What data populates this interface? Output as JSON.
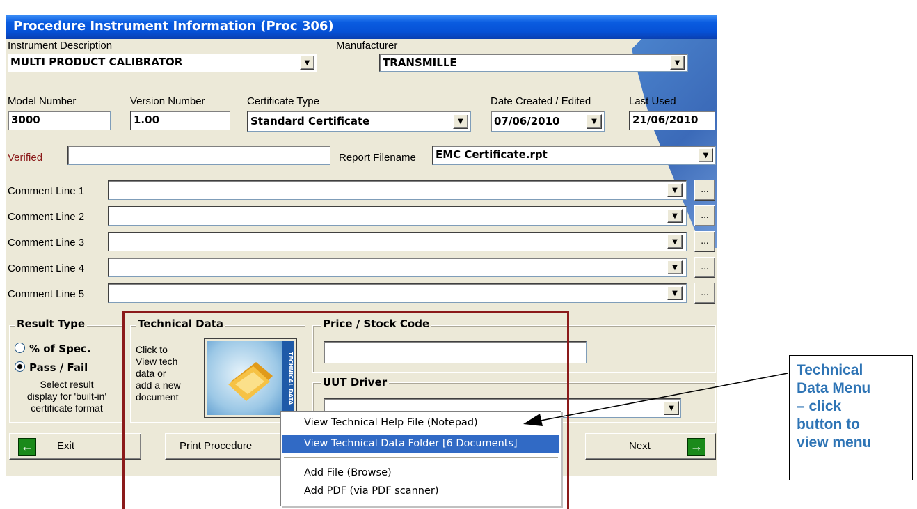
{
  "window": {
    "title": "Procedure Instrument Information (Proc 306)"
  },
  "instrument_description": {
    "label": "Instrument Description",
    "value": "MULTI PRODUCT CALIBRATOR"
  },
  "manufacturer": {
    "label": "Manufacturer",
    "value": "TRANSMILLE"
  },
  "model_number": {
    "label": "Model Number",
    "value": "3000"
  },
  "version_number": {
    "label": "Version Number",
    "value": "1.00"
  },
  "certificate_type": {
    "label": "Certificate Type",
    "value": "Standard Certificate"
  },
  "date_created": {
    "label": "Date Created / Edited",
    "value": "07/06/2010"
  },
  "last_used": {
    "label": "Last Used",
    "value": "21/06/2010"
  },
  "verified": {
    "label": "Verified",
    "value": ""
  },
  "report_filename": {
    "label": "Report Filename",
    "value": "EMC Certificate.rpt"
  },
  "comments": [
    {
      "label": "Comment Line 1",
      "value": ""
    },
    {
      "label": "Comment Line 2",
      "value": ""
    },
    {
      "label": "Comment Line 3",
      "value": ""
    },
    {
      "label": "Comment Line 4",
      "value": ""
    },
    {
      "label": "Comment Line 5",
      "value": ""
    }
  ],
  "ellipsis": "...",
  "result_type": {
    "title": "Result Type",
    "option_spec": "% of Spec.",
    "option_passfail": "Pass / Fail",
    "selected": "Pass / Fail",
    "help_lines": [
      "Select result",
      "display for 'built-in'",
      "certificate format"
    ]
  },
  "technical_data": {
    "title": "Technical Data",
    "help_lines": [
      "Click to",
      "View tech",
      "data or",
      "add a new",
      "document"
    ],
    "button_caption": "TECHNICAL DATA"
  },
  "price_stock": {
    "title": "Price / Stock Code",
    "value": ""
  },
  "uut_driver": {
    "title": "UUT Driver",
    "value": ""
  },
  "buttons": {
    "exit": "Exit",
    "print": "Print Procedure",
    "next": "Next"
  },
  "menu": {
    "items": [
      "View Technical Help File (Notepad)",
      "View Technical Data Folder [6 Documents]",
      "Add File (Browse)",
      "Add PDF (via PDF scanner)"
    ],
    "highlighted_index": 1,
    "highlight_color": "#316ac5"
  },
  "callout": {
    "lines": [
      "Technical",
      "Data Menu",
      "– click",
      "button to",
      "view menu"
    ],
    "color": "#2e74b5"
  },
  "highlight_box_color": "#8b1a1a"
}
